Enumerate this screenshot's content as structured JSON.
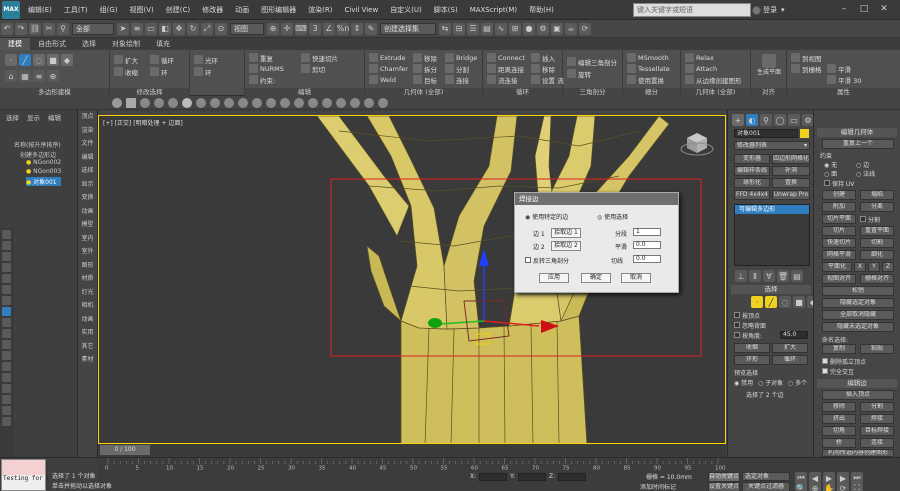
{
  "app": {
    "logo": "MAX",
    "workspace_label": "工作区: 默认",
    "window_title": "Autodesk 3ds Max 2018   树枝.max",
    "search_placeholder": "键入关键字或短语",
    "login": "登录"
  },
  "menu": [
    "编辑(E)",
    "工具(T)",
    "组(G)",
    "视图(V)",
    "创建(C)",
    "修改器",
    "动画",
    "图形编辑器",
    "渲染(R)",
    "Civil View",
    "自定义(U)",
    "脚本(S)",
    "MAXScript(M)",
    "帮助(H)"
  ],
  "toolbar": {
    "selection_filter": "全部",
    "view_mode": "视图",
    "selection_set": "创建选择集",
    "snap_percent": "%n"
  },
  "ribbon_tabs": [
    {
      "label": "建模",
      "active": true
    },
    {
      "label": "自由形式",
      "active": false
    },
    {
      "label": "选择",
      "active": false
    },
    {
      "label": "对象绘制",
      "active": false
    },
    {
      "label": "填充",
      "active": false
    }
  ],
  "ribbon": {
    "groups": [
      "多边形建模",
      "修改选择",
      "编辑",
      "几何体 (全部)",
      "循环",
      "三角剖分",
      "细分",
      "几何体 (全部)",
      "对齐",
      "属性"
    ],
    "items": {
      "g1": [
        "扩大",
        "收缩"
      ],
      "g2": [
        "循环",
        "环"
      ],
      "g3": [
        "光环",
        "环"
      ],
      "g4": [
        "重复",
        "NURMS",
        "约束:"
      ],
      "g5": [
        "快速切片",
        "剪切",
        "快速 循环",
        "绘制连接"
      ],
      "g6": [
        "Extrude",
        "Chamfer",
        "Weld"
      ],
      "g7": [
        "移除",
        "拆分",
        "目标"
      ],
      "g8": [
        "Bridge",
        "分割",
        "连接"
      ],
      "g9": [
        "Connect",
        "距离连接",
        "流连接"
      ],
      "g10": [
        "插入",
        "移除",
        "设置 流"
      ],
      "g11": [
        "编辑三角剖分",
        "旋转"
      ],
      "g12": [
        "MSmooth",
        "Tessellate",
        "使用置换"
      ],
      "g13": [
        "Relax",
        "Attach",
        "从边缘创建图形"
      ],
      "g14": [
        "生成平面"
      ],
      "g15": [
        "到视图",
        "到栅格",
        "平滑",
        "平滑 30"
      ]
    }
  },
  "left": {
    "tabs": [
      "选择",
      "显示",
      "编辑"
    ],
    "tree_header": "名称(按升序排序)",
    "tree": [
      "创建多边形边",
      "NGon002",
      "NGon003",
      "对象001"
    ]
  },
  "cmd_panel": [
    "顶点",
    "渲染",
    "文件",
    "编辑",
    "选择",
    "显示",
    "变换",
    "动画",
    "模型",
    "室内",
    "室外",
    "图形",
    "材质",
    "灯光",
    "相机",
    "动画",
    "实用",
    "其它",
    "素材"
  ],
  "viewport": {
    "label": "[+] [正交] [明暗处理 + 边面]"
  },
  "dialog": {
    "title": "焊接边",
    "opt1": "使用特定的边",
    "opt2": "使用选择",
    "edge1": "边 1",
    "edge1_btn": "拾取边 1",
    "edge2": "边 2",
    "edge2_btn": "拾取边 2",
    "flip": "反转三角剖分",
    "segments": "分段",
    "segments_val": "1",
    "tension": "平滑",
    "tension_val": "0.0",
    "pinch": "切线",
    "pinch_val": "0.0",
    "apply": "应用",
    "ok": "确定",
    "cancel": "取消"
  },
  "right_a": {
    "object_name": "对象001",
    "modifier_list": "修改器列表",
    "btns": [
      [
        "变形器",
        "四边形网格化"
      ],
      [
        "编辑样条线",
        "补洞"
      ],
      [
        "球形化",
        "置换"
      ],
      [
        "FFD 4x4x4",
        "Unwrap Pro"
      ]
    ],
    "stack_item": "可编辑多边形",
    "selection_header": "选择",
    "sel_opts": [
      "按顶点",
      "忽略背面",
      "按角度:"
    ],
    "angle_val": "45.0",
    "btns2": [
      [
        "收缩",
        "扩大"
      ],
      [
        "环形",
        "循环"
      ]
    ],
    "sub_header": "预览选择",
    "sub_opts": [
      "禁用",
      "子对象",
      "多个"
    ],
    "sel_count": "选择了 2 个边"
  },
  "right_b": {
    "header1": "编辑几何体",
    "repeat": "重复上一个",
    "constrain": "约束",
    "c_opts": [
      "无",
      "边",
      "面",
      "法线"
    ],
    "keep_uv": "保持 UV",
    "create": "创建",
    "collapse": "塌陷",
    "attach": "附加",
    "detach": "分离",
    "slice_plane": "切片平面",
    "split": "分割",
    "slice": "切片",
    "reset": "重置平面",
    "quick": "快速切片",
    "cut": "切割",
    "msmooth": "网格平滑",
    "tess": "细化",
    "planar": "平面化",
    "xyz": [
      "X",
      "Y",
      "Z"
    ],
    "view": "视图对齐",
    "grid": "栅格对齐",
    "relax": "松弛",
    "hide": "隐藏选定对象",
    "unhide": "全部取消隐藏",
    "hide_unsel": "隐藏未选定对象",
    "named": "命名选择:",
    "copy": "复制",
    "paste": "粘贴",
    "del_iso": "删除孤立顶点",
    "full_int": "完全交互",
    "header2": "编辑边",
    "insert": "插入顶点",
    "remove": "移除",
    "split2": "分割",
    "extrude": "挤出",
    "weld": "焊接",
    "chamfer": "切角",
    "target": "目标焊接",
    "bridge": "桥",
    "connect": "连接",
    "create_shape": "利用所选内容创建图形",
    "weight": "权重:",
    "weight_val": "1.0",
    "crease": "折缝:",
    "crease_val": "0.0",
    "edit_tri": "编辑三角形",
    "turn": "旋转"
  },
  "timeline": {
    "slider": "0 / 100",
    "ticks": [
      "0",
      "5",
      "10",
      "15",
      "20",
      "25",
      "30",
      "35",
      "40",
      "45",
      "50",
      "55",
      "60",
      "65",
      "70",
      "75",
      "80",
      "85",
      "90",
      "95",
      "100"
    ]
  },
  "status": {
    "maxscript_text": "Testing for ALT",
    "msg1": "选择了 1 个对象",
    "msg2": "单击并拖动以选择对象",
    "x_label": "X:",
    "y_label": "Y:",
    "z_label": "Z:",
    "grid": "栅格 = 10.0mm",
    "add_time": "添加时间标记",
    "auto_key": "自动关键点",
    "set_key": "设置关键点",
    "sel_obj": "选定对象",
    "key_filter": "关键点过滤器"
  }
}
